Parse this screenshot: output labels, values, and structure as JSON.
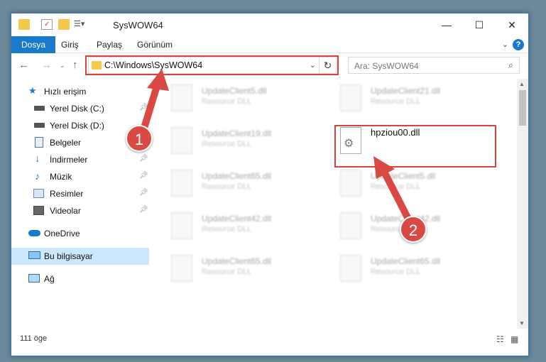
{
  "window": {
    "title": "SysWOW64"
  },
  "ribbon": {
    "tabs": [
      "Dosya",
      "Giriş",
      "Paylaş",
      "Görünüm"
    ]
  },
  "address": {
    "path": "C:\\Windows\\SysWOW64"
  },
  "search": {
    "placeholder": "Ara: SysWOW64"
  },
  "sidebar": {
    "items": [
      {
        "label": "Hızlı erişim",
        "icon": "star-icon",
        "pinned": false
      },
      {
        "label": "Yerel Disk (C:)",
        "icon": "drive-icon",
        "pinned": true
      },
      {
        "label": "Yerel Disk (D:)",
        "icon": "drive-icon",
        "pinned": false
      },
      {
        "label": "Belgeler",
        "icon": "documents-icon",
        "pinned": true
      },
      {
        "label": "İndirmeler",
        "icon": "download-icon",
        "pinned": true
      },
      {
        "label": "Müzik",
        "icon": "music-icon",
        "pinned": true
      },
      {
        "label": "Resimler",
        "icon": "pictures-icon",
        "pinned": true
      },
      {
        "label": "Videolar",
        "icon": "videos-icon",
        "pinned": true
      },
      {
        "label": "OneDrive",
        "icon": "cloud-icon",
        "pinned": false
      },
      {
        "label": "Bu bilgisayar",
        "icon": "computer-icon",
        "pinned": false
      },
      {
        "label": "Ağ",
        "icon": "network-icon",
        "pinned": false
      }
    ]
  },
  "files": [
    {
      "name": "UpdateClient5.dll",
      "type": "Resource DLL"
    },
    {
      "name": "UpdateClient21.dll",
      "type": "Resource DLL"
    },
    {
      "name": "UpdateClient19.dll",
      "type": "Resource DLL"
    },
    {
      "name": "hpziou00.dll",
      "type": ""
    },
    {
      "name": "UpdateClient65.dll",
      "type": "Resource DLL"
    },
    {
      "name": "UpdateClient5.dll",
      "type": "Resource DLL"
    },
    {
      "name": "UpdateClient42.dll",
      "type": "Resource DLL"
    },
    {
      "name": "UpdateClient42.dll",
      "type": "Resource DLL"
    },
    {
      "name": "UpdateClient65.dll",
      "type": "Resource DLL"
    },
    {
      "name": "UpdateClient65.dll",
      "type": "Resource DLL"
    }
  ],
  "status": {
    "count": "111 öge"
  },
  "callouts": [
    "1",
    "2"
  ],
  "colors": {
    "accent": "#1979ca",
    "highlight": "#d9403e",
    "selected": "#cce8ff"
  }
}
